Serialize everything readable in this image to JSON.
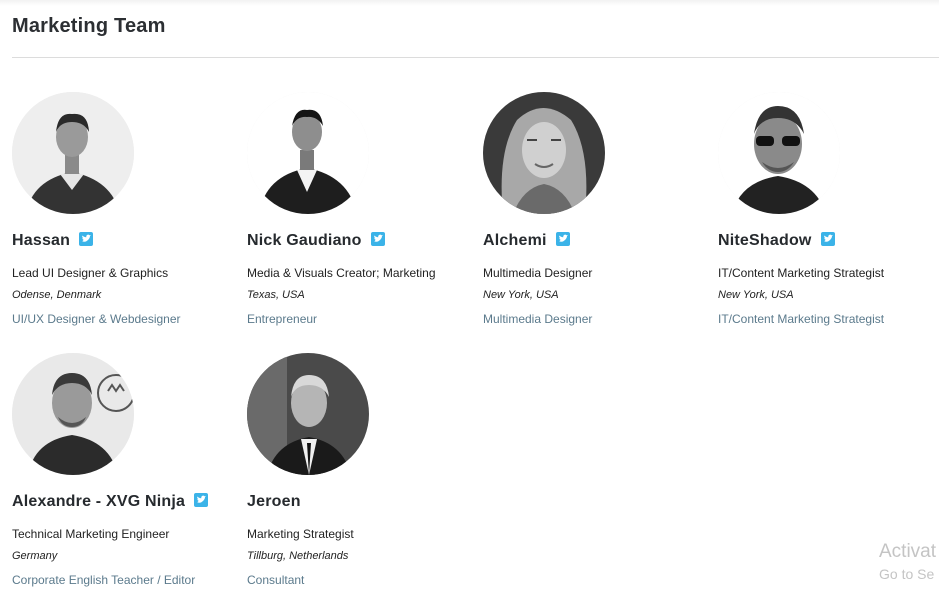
{
  "section": {
    "title": "Marketing Team"
  },
  "members": [
    {
      "name": "Hassan",
      "role": "Lead UI Designer & Graphics",
      "location": "Odense, Denmark",
      "link": "UI/UX Designer & Webdesigner",
      "twitter_icon": "twitter-icon"
    },
    {
      "name": "Nick Gaudiano",
      "role": "Media & Visuals Creator; Marketing",
      "location": "Texas, USA",
      "link": "Entrepreneur",
      "twitter_icon": "twitter-icon"
    },
    {
      "name": "Alchemi",
      "role": "Multimedia Designer",
      "location": "New York, USA",
      "link": "Multimedia Designer",
      "twitter_icon": "twitter-icon"
    },
    {
      "name": "NiteShadow",
      "role": "IT/Content Marketing Strategist",
      "location": "New York, USA",
      "link": "IT/Content Marketing Strategist",
      "twitter_icon": "twitter-icon"
    },
    {
      "name": "Alexandre - XVG Ninja",
      "role": "Technical Marketing Engineer",
      "location": "Germany",
      "link": "Corporate English Teacher / Editor",
      "twitter_icon": "twitter-icon"
    },
    {
      "name": "Jeroen",
      "role": "Marketing Strategist",
      "location": "Tillburg, Netherlands",
      "link": "Consultant"
    }
  ],
  "watermark": {
    "line1": "Activat",
    "line2": "Go to Se"
  },
  "colors": {
    "twitter": "#3bb3e8",
    "link": "#5b7a8c",
    "title": "#2c2f33"
  }
}
